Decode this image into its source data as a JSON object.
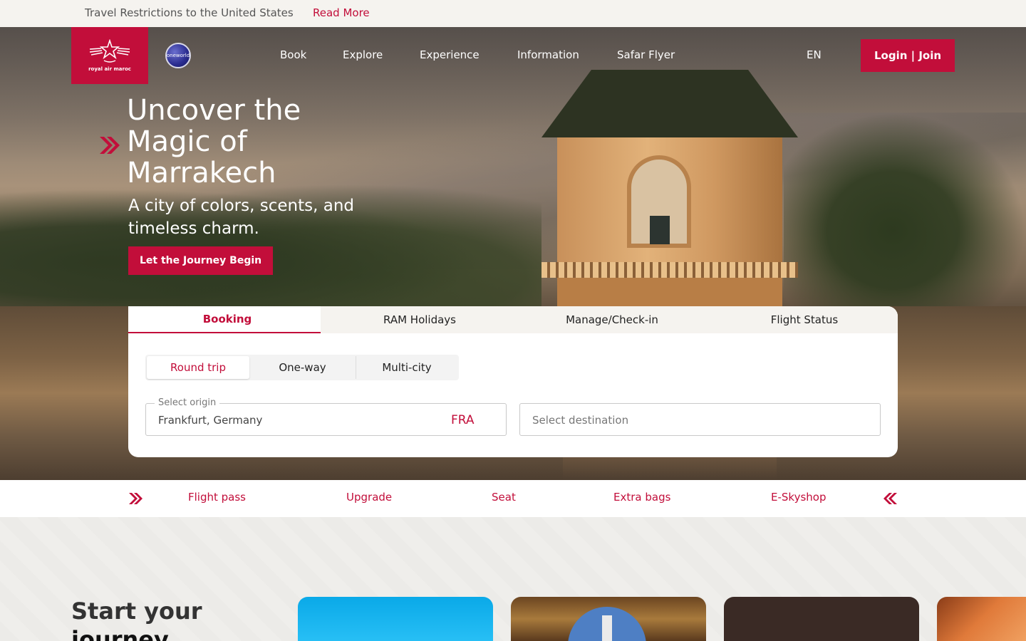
{
  "notice": {
    "text": "Travel Restrictions to the United States",
    "link": "Read More",
    "icon_left_1": "",
    "icon_left_2": "",
    "icon_close": ""
  },
  "header": {
    "logo_text": "royal air maroc",
    "oneworld": "oneworld",
    "nav": [
      "Book",
      "Explore",
      "Experience",
      "Information",
      "Safar Flyer"
    ],
    "search_icon": "",
    "lang": " EN ",
    "login": "Login | Join"
  },
  "hero": {
    "title": "Uncover the Magic of Marrakech",
    "subtitle": "A city of colors, scents, and timeless charm.",
    "cta": "Let the Journey Begin "
  },
  "booking": {
    "tabs": [
      {
        "icon": "",
        "label": "Booking"
      },
      {
        "icon": "",
        "label": "RAM Holidays"
      },
      {
        "icon": "",
        "label": "Manage/Check-in"
      },
      {
        "icon": "",
        "label": "Flight Status"
      }
    ],
    "trip_types": [
      "Round trip",
      "One-way",
      "Multi-city"
    ],
    "origin": {
      "label": "Select origin",
      "value": "Frankfurt, Germany",
      "code": "FRA",
      "icon": ""
    },
    "swap_icon": "",
    "destination": {
      "placeholder": "Select destination",
      "icon": ""
    }
  },
  "quick_links": [
    {
      "icon": "",
      "label": "Flight pass"
    },
    {
      "icon": "",
      "label": "Upgrade"
    },
    {
      "icon": "",
      "label": "Seat"
    },
    {
      "icon": "",
      "label": "Extra bags"
    },
    {
      "icon": "",
      "label": "E-Skyshop"
    }
  ],
  "lower": {
    "title_line1": "Start your",
    "title_line2": "journey"
  },
  "colors": {
    "brand": "#c20e3a",
    "notice_bg": "#f5f3ef"
  }
}
